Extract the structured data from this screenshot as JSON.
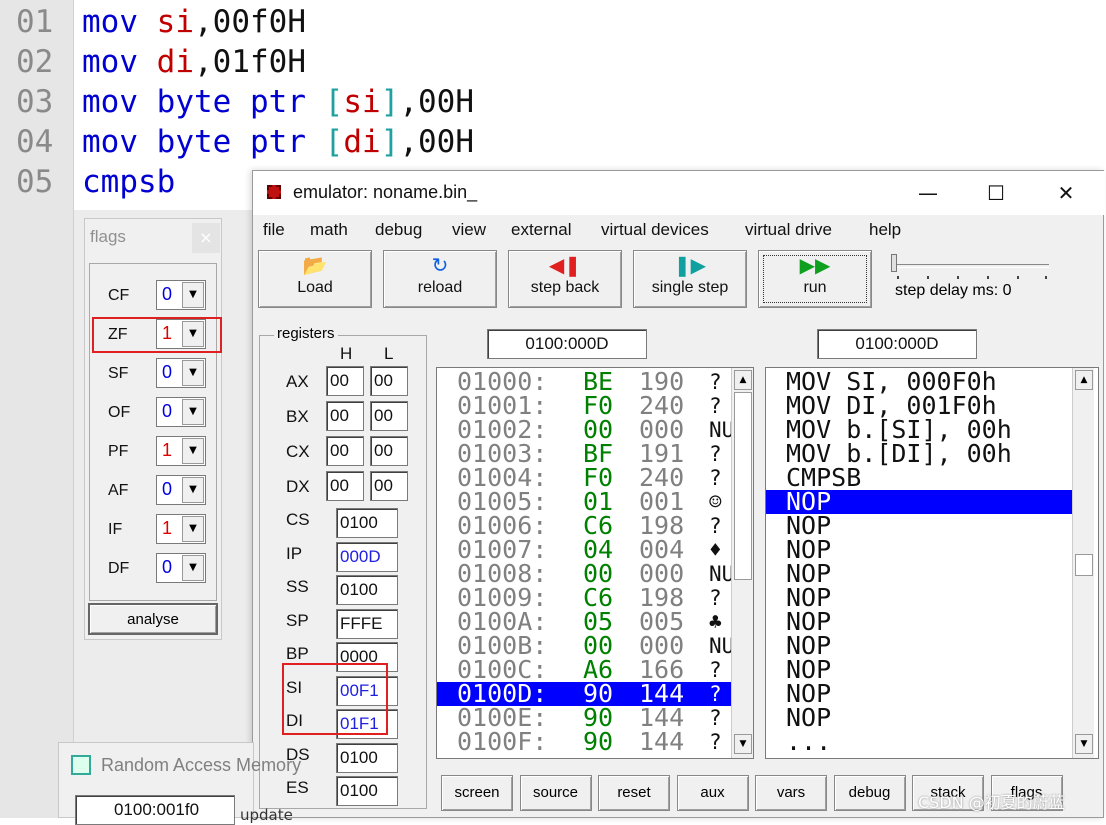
{
  "editor": {
    "lines": [
      {
        "num": "01",
        "parts": [
          "mov",
          " ",
          "si",
          ",",
          "00f0H"
        ]
      },
      {
        "num": "02",
        "parts": [
          "mov",
          " ",
          "di",
          ",",
          "01f0H"
        ]
      },
      {
        "num": "03",
        "parts": [
          "mov",
          " ",
          "byte ptr",
          " ",
          "[",
          "si",
          "]",
          ",",
          "00H"
        ]
      },
      {
        "num": "04",
        "parts": [
          "mov",
          " ",
          "byte ptr",
          " ",
          "[",
          "di",
          "]",
          ",",
          "00H"
        ]
      },
      {
        "num": "05",
        "parts": [
          "cmpsb"
        ]
      }
    ]
  },
  "flags_window": {
    "title": "flags",
    "close": "×",
    "flags": [
      {
        "name": "CF",
        "value": "0",
        "color": "#0000e0"
      },
      {
        "name": "ZF",
        "value": "1",
        "color": "#e00000"
      },
      {
        "name": "SF",
        "value": "0",
        "color": "#0000e0"
      },
      {
        "name": "OF",
        "value": "0",
        "color": "#0000e0"
      },
      {
        "name": "PF",
        "value": "1",
        "color": "#e00000"
      },
      {
        "name": "AF",
        "value": "0",
        "color": "#0000e0"
      },
      {
        "name": "IF",
        "value": "1",
        "color": "#e00000"
      },
      {
        "name": "DF",
        "value": "0",
        "color": "#0000e0"
      }
    ],
    "analyse_label": "analyse"
  },
  "emulator": {
    "title": "emulator: noname.bin_",
    "window_controls": {
      "minimize": "—",
      "maximize": "☐",
      "close": "✕"
    },
    "menu": [
      "file",
      "math",
      "debug",
      "view",
      "external",
      "virtual devices",
      "virtual drive",
      "help"
    ],
    "toolbar": [
      {
        "label": "Load",
        "icon": "folder-icon",
        "glyph": "📂",
        "color": "#c09000"
      },
      {
        "label": "reload",
        "icon": "reload-icon",
        "glyph": "↻",
        "color": "#1060e0"
      },
      {
        "label": "step back",
        "icon": "step-back-icon",
        "glyph": "◀❚",
        "color": "#e02020"
      },
      {
        "label": "single step",
        "icon": "single-step-icon",
        "glyph": "❚▶",
        "color": "#10a0a0"
      },
      {
        "label": "run",
        "icon": "run-icon",
        "glyph": "▶▶",
        "color": "#10a020"
      }
    ],
    "step_delay_label": "step delay ms: 0",
    "registers": {
      "title": "registers",
      "col_h": "H",
      "col_l": "L",
      "general": [
        {
          "name": "AX",
          "h": "00",
          "l": "00"
        },
        {
          "name": "BX",
          "h": "00",
          "l": "00"
        },
        {
          "name": "CX",
          "h": "00",
          "l": "00"
        },
        {
          "name": "DX",
          "h": "00",
          "l": "00"
        }
      ],
      "segment": [
        {
          "name": "CS",
          "value": "0100",
          "color": "#111111"
        },
        {
          "name": "IP",
          "value": "000D",
          "color": "#2020e0"
        },
        {
          "name": "SS",
          "value": "0100",
          "color": "#111111"
        },
        {
          "name": "SP",
          "value": "FFFE",
          "color": "#111111"
        },
        {
          "name": "BP",
          "value": "0000",
          "color": "#111111"
        },
        {
          "name": "SI",
          "value": "00F1",
          "color": "#2020e0"
        },
        {
          "name": "DI",
          "value": "01F1",
          "color": "#2020e0"
        },
        {
          "name": "DS",
          "value": "0100",
          "color": "#111111"
        },
        {
          "name": "ES",
          "value": "0100",
          "color": "#111111"
        }
      ]
    },
    "memory_address": "0100:000D",
    "disasm_address": "0100:000D",
    "memory": [
      {
        "addr": "01000:",
        "hex": "BE",
        "dec": "190",
        "chr": "?"
      },
      {
        "addr": "01001:",
        "hex": "F0",
        "dec": "240",
        "chr": "?"
      },
      {
        "addr": "01002:",
        "hex": "00",
        "dec": "000",
        "chr": "NU"
      },
      {
        "addr": "01003:",
        "hex": "BF",
        "dec": "191",
        "chr": "?"
      },
      {
        "addr": "01004:",
        "hex": "F0",
        "dec": "240",
        "chr": "?"
      },
      {
        "addr": "01005:",
        "hex": "01",
        "dec": "001",
        "chr": "☺"
      },
      {
        "addr": "01006:",
        "hex": "C6",
        "dec": "198",
        "chr": "?"
      },
      {
        "addr": "01007:",
        "hex": "04",
        "dec": "004",
        "chr": "♦"
      },
      {
        "addr": "01008:",
        "hex": "00",
        "dec": "000",
        "chr": "NU"
      },
      {
        "addr": "01009:",
        "hex": "C6",
        "dec": "198",
        "chr": "?"
      },
      {
        "addr": "0100A:",
        "hex": "05",
        "dec": "005",
        "chr": "♣"
      },
      {
        "addr": "0100B:",
        "hex": "00",
        "dec": "000",
        "chr": "NU"
      },
      {
        "addr": "0100C:",
        "hex": "A6",
        "dec": "166",
        "chr": "?"
      },
      {
        "addr": "0100D:",
        "hex": "90",
        "dec": "144",
        "chr": "?",
        "selected": true
      },
      {
        "addr": "0100E:",
        "hex": "90",
        "dec": "144",
        "chr": "?"
      },
      {
        "addr": "0100F:",
        "hex": "90",
        "dec": "144",
        "chr": "?"
      }
    ],
    "disasm": [
      "MOV SI, 000F0h",
      "MOV DI, 001F0h",
      "MOV b.[SI], 00h",
      "MOV b.[DI], 00h",
      "CMPSB",
      "NOP",
      "NOP",
      "NOP",
      "NOP",
      "NOP",
      "NOP",
      "NOP",
      "NOP",
      "NOP",
      "NOP",
      "..."
    ],
    "disasm_selected_index": 5,
    "bottom_buttons": [
      "screen",
      "source",
      "reset",
      "aux",
      "vars",
      "debug",
      "stack",
      "flags"
    ]
  },
  "ram_window": {
    "title": "Random Access Memory",
    "address": "0100:001f0",
    "update_label": "update"
  },
  "watermark": "CSDN @初夏的蔚蓝"
}
